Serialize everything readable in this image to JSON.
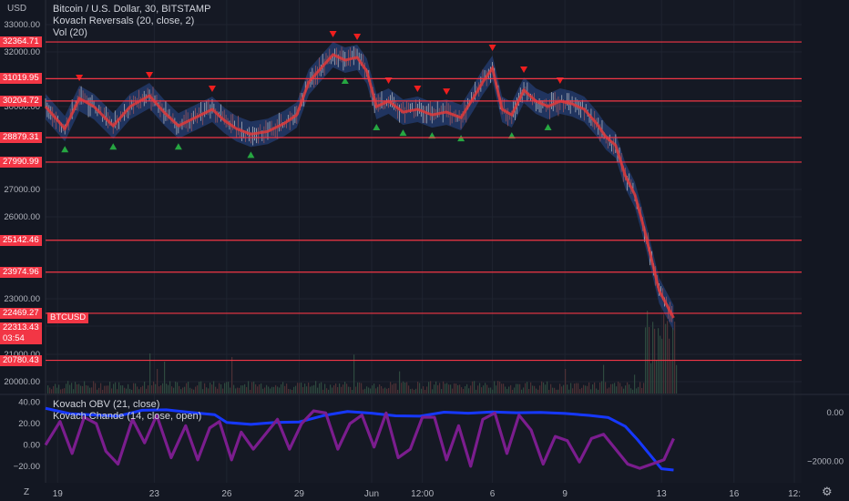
{
  "header": {
    "currency": "USD",
    "title": "Bitcoin / U.S. Dollar, 30, BITSTAMP",
    "indicator1": "Kovach Reversals (20, close, 2)",
    "indicator2": "Vol (20)"
  },
  "ticker": "BTCUSD",
  "price_badge": {
    "price": "22313.43",
    "countdown": "03:54"
  },
  "lower_pane": {
    "legend1": "Kovach OBV (21, close)",
    "legend2": "Kovach Chande (14, close, open)"
  },
  "footer": {
    "left_icon": "Z",
    "right_icon": "⚙"
  },
  "colors": {
    "background": "#131722",
    "grid": "#1f2430",
    "level": "#f23645",
    "candle_band": "#2a4a8f",
    "signal_ma": "#e03a3a",
    "up_marker": "#26a641",
    "down_marker": "#ef1e1e",
    "obv": "#1638ff",
    "chande": "#7b1d8e",
    "volume": "#5a3a3a"
  },
  "chart_data": [
    {
      "type": "line",
      "title": "Bitcoin / U.S. Dollar, 30, BITSTAMP",
      "ylim": [
        19300,
        33600
      ],
      "y_ticks": [
        20000,
        21000,
        22000,
        23000,
        26000,
        27000,
        30000,
        32000,
        33000
      ],
      "y_tick_labels": [
        "20000.00",
        "21000.00",
        "22000.00",
        "23000.00",
        "26000.00",
        "27000.00",
        "30000.00",
        "32000.00",
        "33000.00"
      ],
      "x_ticks": [
        {
          "label": "19",
          "pos": 0.5
        },
        {
          "label": "23",
          "pos": 4.5
        },
        {
          "label": "26",
          "pos": 7.5
        },
        {
          "label": "29",
          "pos": 10.5
        },
        {
          "label": "Jun",
          "pos": 13.5
        },
        {
          "label": "12:00",
          "pos": 15.6
        },
        {
          "label": "6",
          "pos": 18.5
        },
        {
          "label": "9",
          "pos": 21.5
        },
        {
          "label": "13",
          "pos": 25.5
        },
        {
          "label": "16",
          "pos": 28.5
        },
        {
          "label": "12:",
          "pos": 31.0
        }
      ],
      "xlim": [
        0,
        31.3
      ],
      "levels": [
        32364.71,
        31019.95,
        30204.72,
        28879.31,
        27990.99,
        25142.46,
        23974.96,
        22469.27,
        20780.43
      ],
      "level_labels": [
        "32364.71",
        "31019.95",
        "30204.72",
        "28879.31",
        "27990.99",
        "25142.46",
        "23974.96",
        "22469.27",
        "20780.43"
      ],
      "series": [
        {
          "x": [
            0,
            0.8,
            1.4,
            2,
            2.8,
            3.5,
            4.3,
            4.9,
            5.5,
            6.2,
            6.9,
            7.4,
            7.9,
            8.5,
            9.2,
            9.9,
            10.4,
            10.9,
            11.4,
            11.9,
            12.4,
            12.9,
            13.3,
            13.7,
            14.2,
            14.8,
            15.4,
            16.0,
            16.6,
            17.2,
            17.7,
            18.1,
            18.5,
            18.9,
            19.3,
            19.8,
            20.3,
            20.8,
            21.3,
            21.8,
            22.3,
            22.8,
            23.2,
            23.6,
            24.0,
            24.4,
            24.8,
            25.1,
            25.4,
            25.7,
            26.0
          ],
          "values": [
            30000,
            29200,
            30300,
            30000,
            29300,
            30000,
            30400,
            29800,
            29300,
            29600,
            29900,
            29500,
            29200,
            29000,
            29100,
            29400,
            29700,
            30900,
            31400,
            31900,
            31700,
            31800,
            31300,
            30000,
            30200,
            29800,
            29900,
            29700,
            29800,
            29600,
            30300,
            30900,
            31400,
            29900,
            29700,
            30600,
            30200,
            30000,
            30200,
            30100,
            29900,
            29400,
            28900,
            28600,
            27500,
            26800,
            25500,
            24400,
            23300,
            22800,
            22300
          ]
        }
      ]
    },
    {
      "type": "line",
      "title": "Kovach OBV (21, close)",
      "left_ylim": [
        -27,
        44
      ],
      "left_ticks": [
        40,
        20,
        0,
        -20
      ],
      "left_tick_labels": [
        "40.00",
        "20.00",
        "0.00",
        "−20.00"
      ],
      "right_ylim": [
        -2500,
        600
      ],
      "right_ticks": [
        0,
        -2000
      ],
      "right_tick_labels": [
        "0.00",
        "−2000.00"
      ],
      "series": [
        {
          "name": "Kovach OBV (21, close)",
          "axis": "right",
          "x": [
            0,
            1,
            2,
            3,
            4,
            5,
            6,
            7,
            7.5,
            8.5,
            9.5,
            10.5,
            11.5,
            12.5,
            13.5,
            14.5,
            15.5,
            16.5,
            17.5,
            18.5,
            19.5,
            20.5,
            21.5,
            22.5,
            23.3,
            24,
            24.5,
            25,
            25.5,
            26
          ],
          "values": [
            180,
            -40,
            -90,
            -140,
            100,
            120,
            10,
            -80,
            -400,
            -480,
            -400,
            -380,
            -120,
            50,
            -20,
            -130,
            -140,
            20,
            -20,
            30,
            0,
            10,
            -30,
            -110,
            -200,
            -560,
            -1100,
            -1700,
            -2300,
            -2350
          ]
        },
        {
          "name": "Kovach Chande (14, close, open)",
          "axis": "left",
          "x": [
            0,
            0.6,
            1.1,
            1.6,
            2.1,
            2.5,
            3.0,
            3.6,
            4.1,
            4.6,
            5.2,
            5.8,
            6.3,
            6.8,
            7.2,
            7.7,
            8.1,
            8.6,
            9.1,
            9.6,
            10.1,
            10.6,
            11.1,
            11.6,
            12.1,
            12.6,
            13.1,
            13.6,
            14.1,
            14.6,
            15.1,
            15.6,
            16.1,
            16.6,
            17.1,
            17.6,
            18.1,
            18.6,
            19.1,
            19.6,
            20.1,
            20.6,
            21.1,
            21.6,
            22.1,
            22.6,
            23.1,
            23.6,
            24.1,
            24.6,
            25.1,
            25.6,
            26.0
          ],
          "values": [
            0,
            22,
            -8,
            26,
            20,
            -6,
            -18,
            24,
            2,
            28,
            -12,
            18,
            -14,
            16,
            22,
            -14,
            12,
            -4,
            10,
            24,
            -4,
            20,
            32,
            30,
            -4,
            20,
            28,
            -2,
            30,
            -12,
            -4,
            26,
            26,
            -14,
            18,
            -20,
            24,
            30,
            -8,
            28,
            14,
            -18,
            8,
            4,
            -16,
            6,
            10,
            -4,
            -18,
            -22,
            -18,
            -14,
            6
          ]
        }
      ]
    }
  ]
}
